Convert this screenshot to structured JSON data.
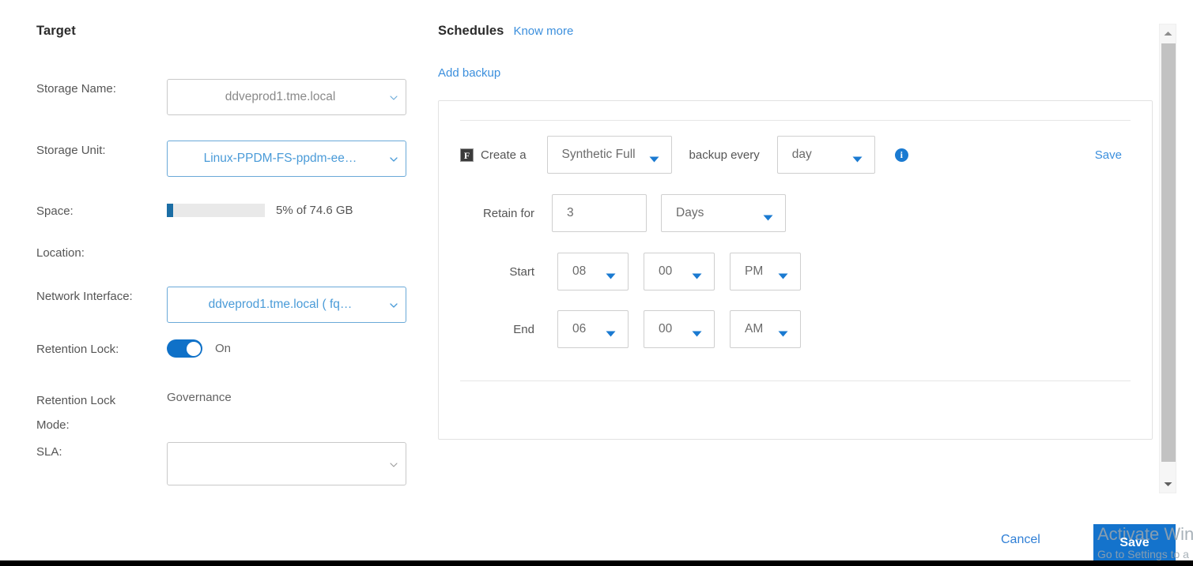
{
  "target": {
    "title": "Target",
    "storage_name": {
      "label": "Storage Name:",
      "value": "ddveprod1.tme.local"
    },
    "storage_unit": {
      "label": "Storage Unit:",
      "value": "Linux-PPDM-FS-ppdm-ee…"
    },
    "space": {
      "label": "Space:",
      "value": "5% of 74.6 GB",
      "percent": 5
    },
    "location": {
      "label": "Location:",
      "value": ""
    },
    "network_interface": {
      "label": "Network Interface:",
      "value": "ddveprod1.tme.local ( fq…"
    },
    "retention_lock": {
      "label": "Retention Lock:",
      "state": "On"
    },
    "retention_lock_mode": {
      "label_line1": "Retention Lock",
      "label_line2": "Mode:",
      "value": "Governance"
    },
    "sla": {
      "label": "SLA:",
      "value": ""
    }
  },
  "schedules": {
    "title": "Schedules",
    "know_more": "Know more",
    "add_backup": "Add backup",
    "rule": {
      "type_icon_letter": "F",
      "create_a": "Create a",
      "backup_type": "Synthetic Full",
      "backup_every": "backup every",
      "frequency": "day",
      "info_icon_letter": "i",
      "save_link": "Save",
      "retain_for_label": "Retain for",
      "retain_for_value": "3",
      "retain_unit": "Days",
      "start_label": "Start",
      "start_hour": "08",
      "start_minute": "00",
      "start_meridiem": "PM",
      "end_label": "End",
      "end_hour": "06",
      "end_minute": "00",
      "end_meridiem": "AM"
    }
  },
  "footer": {
    "cancel": "Cancel",
    "save": "Save"
  },
  "watermark": {
    "title": "Activate Wind",
    "subtitle": "Go to Settings to a"
  },
  "colors": {
    "accent_blue": "#1473cc",
    "link_blue": "#3b8fdd",
    "toggle_blue": "#0f71c8",
    "space_fill": "#1b6ea5"
  }
}
